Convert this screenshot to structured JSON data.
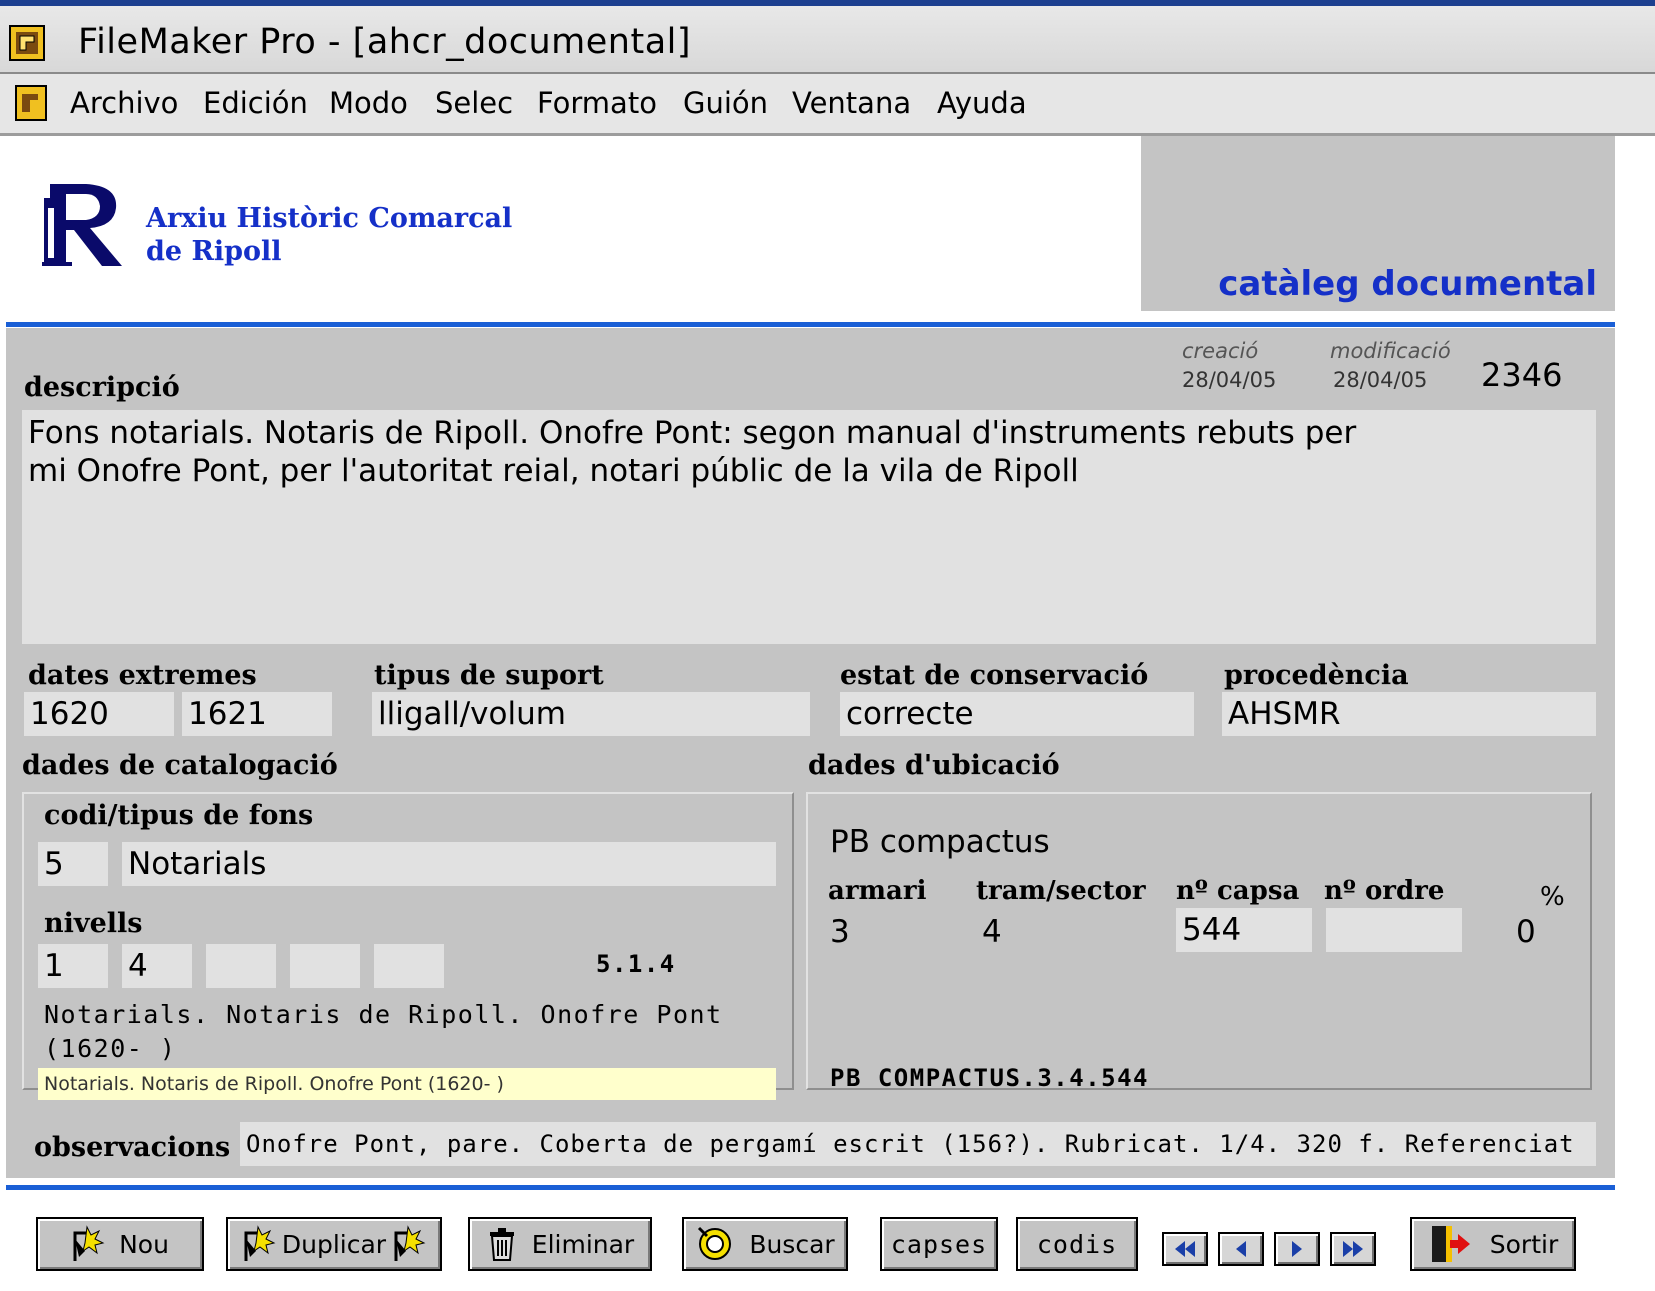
{
  "window": {
    "title": "FileMaker Pro - [ahcr_documental]"
  },
  "menu": {
    "items": [
      "Archivo",
      "Edición",
      "Modo",
      "Selec",
      "Formato",
      "Guión",
      "Ventana",
      "Ayuda"
    ]
  },
  "header": {
    "org_line1": "Arxiu Històric Comarcal",
    "org_line2": "de Ripoll",
    "catalog_title": "catàleg documental"
  },
  "record": {
    "created_label": "creació",
    "created_value": "28/04/05",
    "modified_label": "modificació",
    "modified_value": "28/04/05",
    "record_id": "2346"
  },
  "description": {
    "label": "descripció",
    "line1": "Fons notarials. Notaris de Ripoll. Onofre Pont: segon manual d'instruments rebuts per",
    "line2": "mi Onofre Pont, per l'autoritat reial, notari públic de la vila de Ripoll"
  },
  "dates": {
    "label": "dates extremes",
    "start": "1620",
    "end": "1621"
  },
  "support": {
    "label": "tipus de suport",
    "value": "lligall/volum"
  },
  "conservation": {
    "label": "estat de conservació",
    "value": "correcte"
  },
  "provenance": {
    "label": "procedència",
    "value": "AHSMR"
  },
  "cataloging": {
    "section_label": "dades de catalogació",
    "fonds_label": "codi/tipus de fons",
    "fonds_code": "5",
    "fonds_type": "Notarials",
    "levels_label": "nivells",
    "levels": [
      "1",
      "4",
      "",
      "",
      ""
    ],
    "level_code": "5.1.4",
    "level_text_line1": "Notarials. Notaris de Ripoll. Onofre Pont",
    "level_text_line2": "(1620- )",
    "level_text_highlight": "Notarials. Notaris de Ripoll. Onofre Pont (1620- )"
  },
  "location": {
    "section_label": "dades d'ubicació",
    "place": "PB compactus",
    "col_armari": "armari",
    "col_tram": "tram/sector",
    "col_capsa": "nº capsa",
    "col_ordre": "nº ordre",
    "col_pct": "%",
    "armari": "3",
    "tram": "4",
    "capsa": "544",
    "ordre": "",
    "pct": "0",
    "signature": "PB COMPACTUS.3.4.544"
  },
  "observations": {
    "label": "observacions",
    "value": "Onofre Pont, pare. Coberta de pergamí escrit (156?). Rubricat. 1/4. 320 f. Referenciat"
  },
  "buttons": {
    "new": "Nou",
    "duplicate": "Duplicar",
    "delete": "Eliminar",
    "search": "Buscar",
    "boxes": "capses",
    "codes": "codis",
    "exit": "Sortir"
  },
  "colors": {
    "accent_blue": "#1530c8",
    "line_blue": "#1a5fd6",
    "panel_grey": "#c4c4c4",
    "field_grey": "#e1e1e1",
    "highlight": "#ffffcc"
  }
}
